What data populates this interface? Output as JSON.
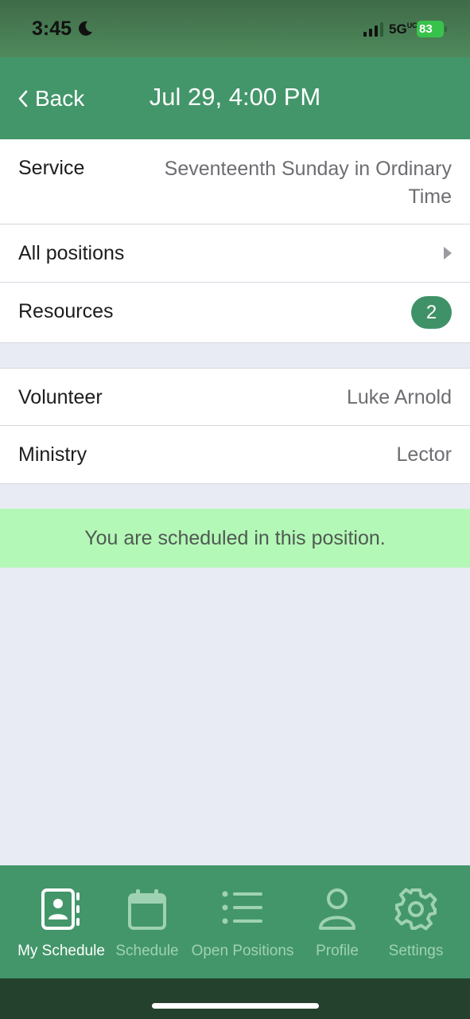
{
  "status_bar": {
    "time": "3:45",
    "network": "5G",
    "network_super": "UC",
    "battery": "83"
  },
  "nav": {
    "back_label": "Back",
    "title": "Jul 29, 4:00 PM"
  },
  "details": {
    "service_label": "Service",
    "service_value": "Seventeenth Sunday in Ordinary Time",
    "positions_label": "All positions",
    "resources_label": "Resources",
    "resources_count": "2",
    "volunteer_label": "Volunteer",
    "volunteer_value": "Luke Arnold",
    "ministry_label": "Ministry",
    "ministry_value": "Lector"
  },
  "banner": {
    "text": "You are scheduled in this position."
  },
  "tabs": [
    {
      "label": "My Schedule",
      "icon": "contact-book-icon",
      "active": true
    },
    {
      "label": "Schedule",
      "icon": "calendar-icon",
      "active": false
    },
    {
      "label": "Open Positions",
      "icon": "list-icon",
      "active": false
    },
    {
      "label": "Profile",
      "icon": "person-icon",
      "active": false
    },
    {
      "label": "Settings",
      "icon": "gear-icon",
      "active": false
    }
  ],
  "colors": {
    "brand_green": "#43966a",
    "badge_green": "#3f9267",
    "banner_green": "#b4f8b7",
    "background": "#e9ebf4"
  }
}
